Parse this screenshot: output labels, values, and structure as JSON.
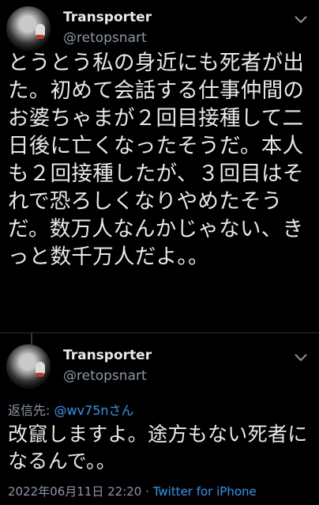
{
  "tweet1": {
    "display_name": "Transporter",
    "handle": "@retopsnart",
    "text": "とうとう私の身近にも死者が出た。初めて会話する仕事仲間のお婆ちゃまが２回目接種して二日後に亡くなったそうだ。本人も２回接種したが、３回目はそれで恐ろしくなりやめたそうだ。数万人なんかじゃない、きっと数千万人だよ。。",
    "more_icon": "chevron-down-icon"
  },
  "tweet2": {
    "display_name": "Transporter",
    "handle": "@retopsnart",
    "replying_prefix": "返信先: ",
    "replying_to": "@wv75n",
    "replying_suffix": "さん",
    "text": "改竄しますよ。途方もない死者になるんで。。",
    "date": "2022年06月11日 22:20",
    "separator": "·",
    "source": "Twitter for iPhone",
    "more_icon": "chevron-down-icon"
  },
  "colors": {
    "background": "#000000",
    "text": "#e7e9ea",
    "secondary": "#8b98a5",
    "link": "#1d9bf0"
  }
}
